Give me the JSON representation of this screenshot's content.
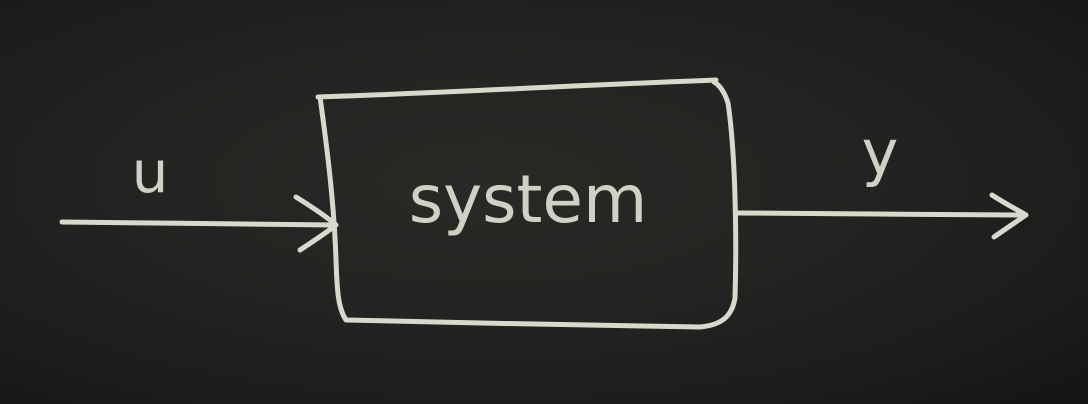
{
  "diagram": {
    "block_label": "system",
    "input_label": "u",
    "output_label": "y"
  },
  "colors": {
    "board": "#1f1e1c",
    "chalk": "#d8d8cc"
  }
}
